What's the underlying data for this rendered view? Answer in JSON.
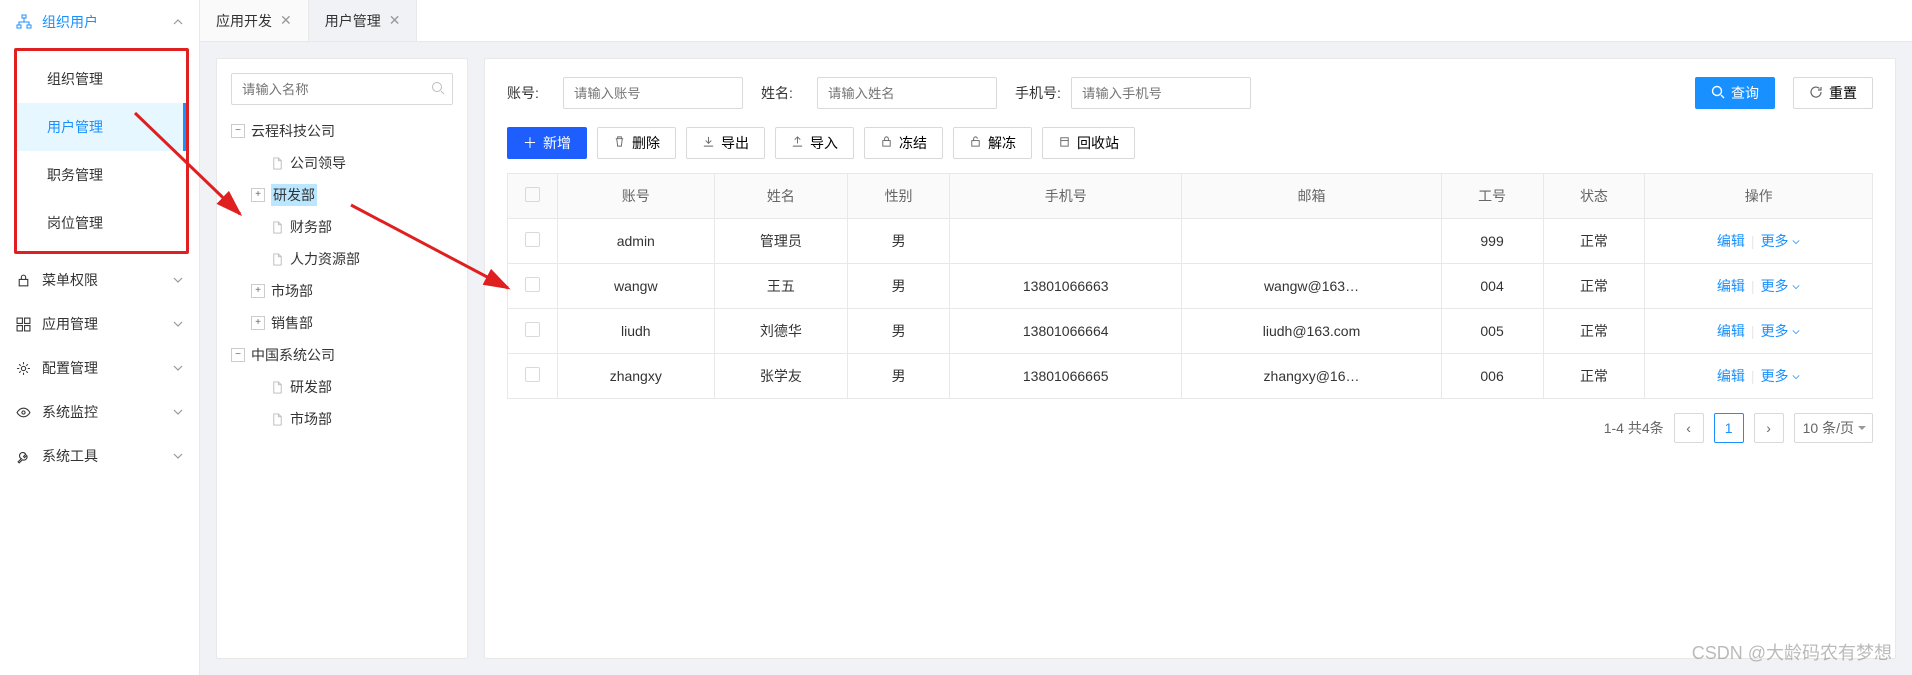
{
  "sidebar": {
    "group1": {
      "label": "组织用户",
      "items": [
        "组织管理",
        "用户管理",
        "职务管理",
        "岗位管理"
      ],
      "active_index": 1
    },
    "others": [
      {
        "label": "菜单权限",
        "icon": "lock"
      },
      {
        "label": "应用管理",
        "icon": "grid"
      },
      {
        "label": "配置管理",
        "icon": "gear"
      },
      {
        "label": "系统监控",
        "icon": "eye"
      },
      {
        "label": "系统工具",
        "icon": "wrench"
      }
    ]
  },
  "tabs": [
    {
      "label": "应用开发",
      "active": false
    },
    {
      "label": "用户管理",
      "active": true
    }
  ],
  "tree": {
    "search_placeholder": "请输入名称",
    "root1": {
      "label": "云程科技公司",
      "children": [
        {
          "label": "公司领导",
          "leaf": true
        },
        {
          "label": "研发部",
          "leaf": false,
          "selected": true
        },
        {
          "label": "财务部",
          "leaf": true
        },
        {
          "label": "人力资源部",
          "leaf": true
        },
        {
          "label": "市场部",
          "leaf": false
        },
        {
          "label": "销售部",
          "leaf": false
        }
      ]
    },
    "root2": {
      "label": "中国系统公司",
      "children": [
        {
          "label": "研发部",
          "leaf": true
        },
        {
          "label": "市场部",
          "leaf": true
        }
      ]
    }
  },
  "filters": {
    "account": {
      "label": "账号:",
      "placeholder": "请输入账号"
    },
    "name": {
      "label": "姓名:",
      "placeholder": "请输入姓名"
    },
    "phone": {
      "label": "手机号:",
      "placeholder": "请输入手机号"
    },
    "search_btn": "查询",
    "reset_btn": "重置"
  },
  "toolbar": {
    "add": "新增",
    "delete": "删除",
    "export": "导出",
    "import": "导入",
    "freeze": "冻结",
    "unfreeze": "解冻",
    "recycle": "回收站"
  },
  "table": {
    "headers": [
      "账号",
      "姓名",
      "性别",
      "手机号",
      "邮箱",
      "工号",
      "状态",
      "操作"
    ],
    "rows": [
      {
        "account": "admin",
        "name": "管理员",
        "gender": "男",
        "phone": "",
        "email": "",
        "empno": "999",
        "status": "正常"
      },
      {
        "account": "wangw",
        "name": "王五",
        "gender": "男",
        "phone": "13801066663",
        "email": "wangw@163…",
        "empno": "004",
        "status": "正常"
      },
      {
        "account": "liudh",
        "name": "刘德华",
        "gender": "男",
        "phone": "13801066664",
        "email": "liudh@163.com",
        "empno": "005",
        "status": "正常"
      },
      {
        "account": "zhangxy",
        "name": "张学友",
        "gender": "男",
        "phone": "13801066665",
        "email": "zhangxy@16…",
        "empno": "006",
        "status": "正常"
      }
    ],
    "op_edit": "编辑",
    "op_more": "更多"
  },
  "pagination": {
    "summary": "1-4 共4条",
    "current": "1",
    "size": "10 条/页"
  },
  "watermark": "CSDN @大龄码农有梦想"
}
